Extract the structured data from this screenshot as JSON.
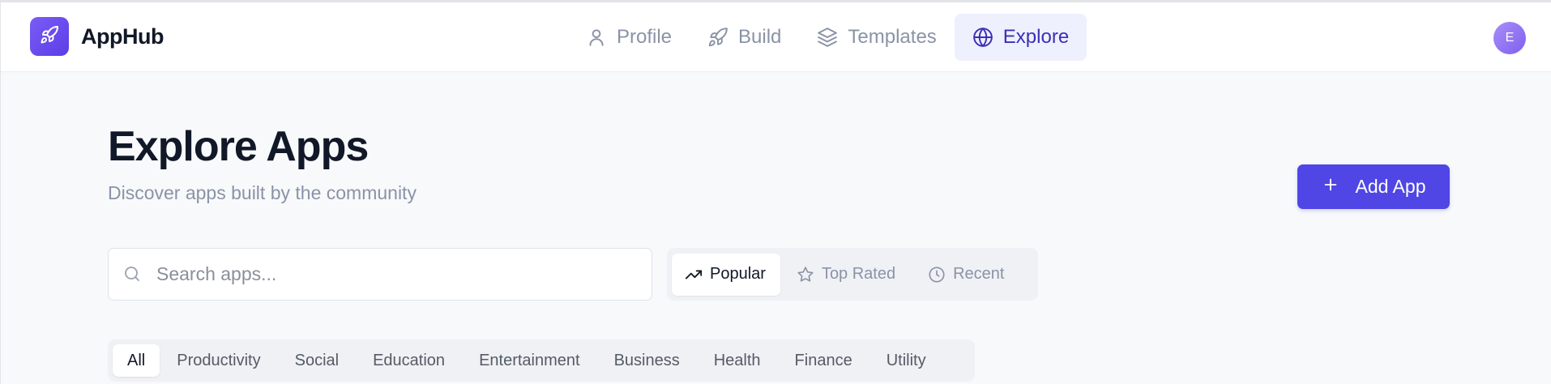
{
  "app": {
    "name": "AppHub",
    "brand_color": "#4f46e5"
  },
  "nav": {
    "items": [
      {
        "label": "Profile",
        "icon": "user-icon",
        "active": false
      },
      {
        "label": "Build",
        "icon": "rocket-icon",
        "active": false
      },
      {
        "label": "Templates",
        "icon": "layers-icon",
        "active": false
      },
      {
        "label": "Explore",
        "icon": "globe-icon",
        "active": true
      }
    ]
  },
  "user": {
    "avatar_initial": "E"
  },
  "header": {
    "title": "Explore Apps",
    "subtitle": "Discover apps built by the community",
    "add_button_label": "Add App"
  },
  "search": {
    "placeholder": "Search apps...",
    "value": ""
  },
  "sort": {
    "options": [
      {
        "label": "Popular",
        "icon": "trending-up-icon",
        "active": true
      },
      {
        "label": "Top Rated",
        "icon": "star-icon",
        "active": false
      },
      {
        "label": "Recent",
        "icon": "clock-icon",
        "active": false
      }
    ]
  },
  "categories": {
    "items": [
      "All",
      "Productivity",
      "Social",
      "Education",
      "Entertainment",
      "Business",
      "Health",
      "Finance",
      "Utility"
    ],
    "selected": "All"
  }
}
